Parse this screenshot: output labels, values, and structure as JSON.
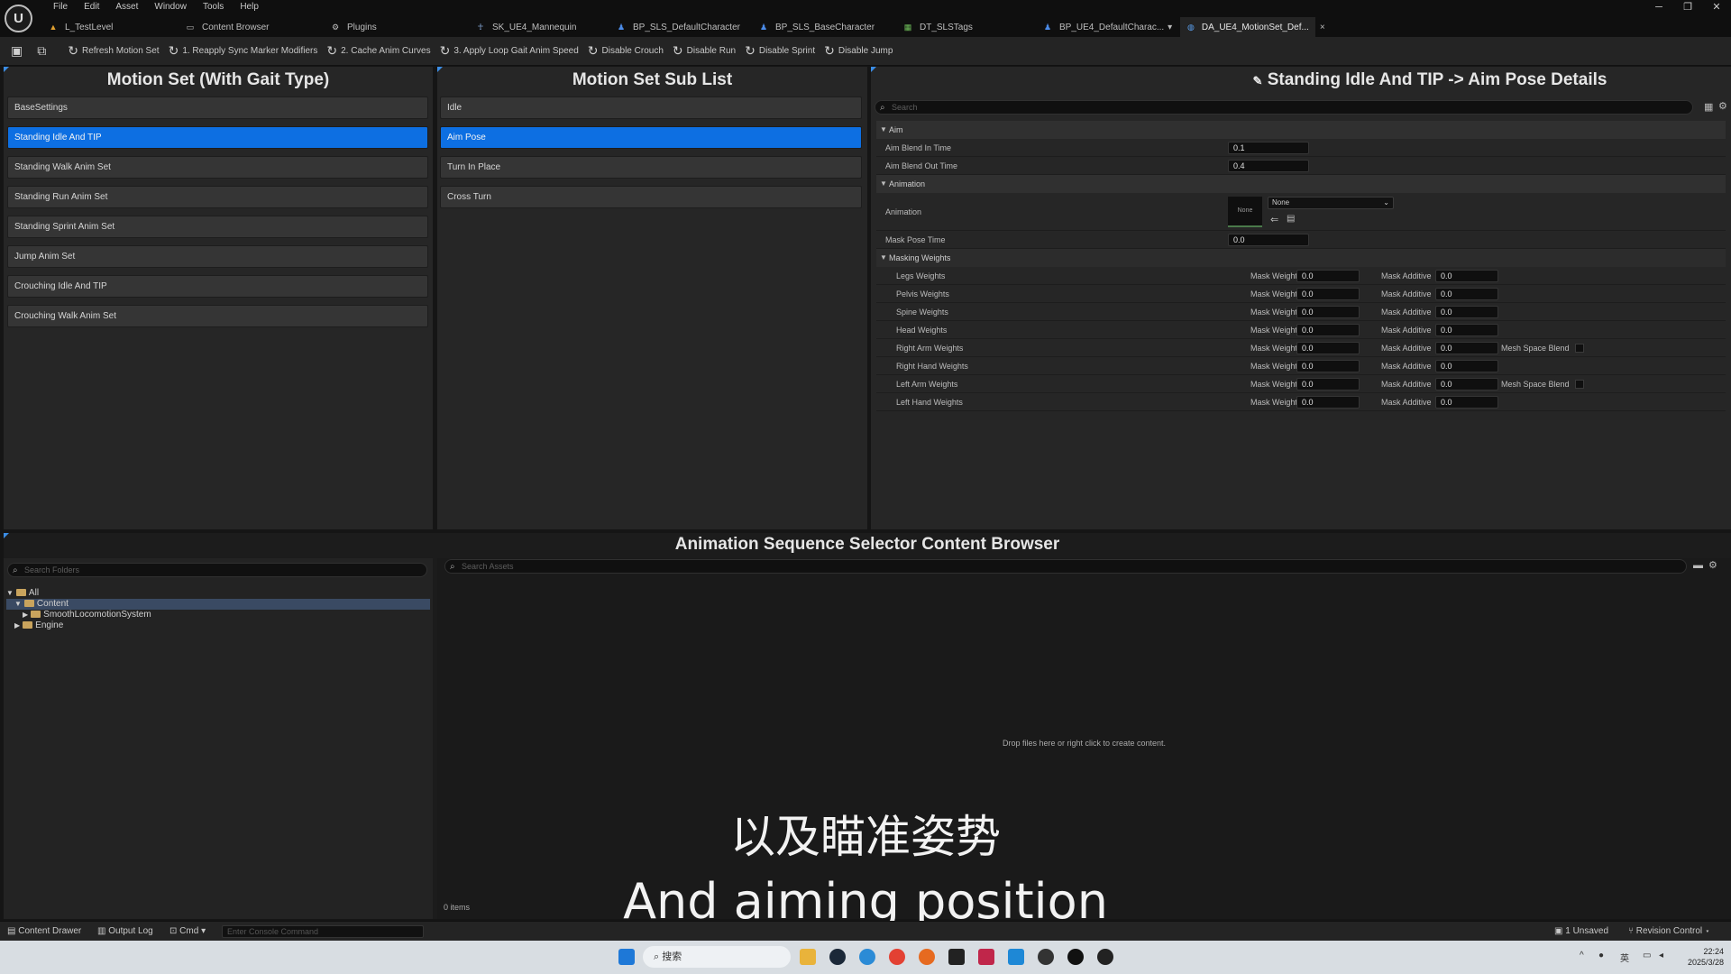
{
  "titlebar": {
    "logo": "U",
    "menus": [
      "File",
      "Edit",
      "Asset",
      "Window",
      "Tools",
      "Help"
    ],
    "tabs": [
      {
        "label": "L_TestLevel",
        "icon": "level-icon",
        "active": false
      },
      {
        "label": "Content Browser",
        "icon": "folder-icon",
        "active": false
      },
      {
        "label": "Plugins",
        "icon": "plugin-icon",
        "active": false
      },
      {
        "label": "SK_UE4_Mannequin",
        "icon": "skeleton-icon",
        "active": false
      },
      {
        "label": "BP_SLS_DefaultCharacter",
        "icon": "blueprint-icon",
        "active": false
      },
      {
        "label": "BP_SLS_BaseCharacter",
        "icon": "blueprint-icon",
        "active": false
      },
      {
        "label": "DT_SLSTags",
        "icon": "datatable-icon",
        "active": false
      },
      {
        "label": "BP_UE4_DefaultCharac...",
        "icon": "blueprint-icon",
        "active": false
      },
      {
        "label": "DA_UE4_MotionSet_Def...",
        "icon": "data-asset-icon",
        "active": true
      }
    ],
    "window_controls": [
      "─",
      "❐",
      "✕"
    ]
  },
  "toolbar": {
    "items": [
      "Refresh Motion Set",
      "1. Reapply Sync Marker Modifiers",
      "2. Cache Anim Curves",
      "3. Apply Loop Gait Anim Speed",
      "Disable Crouch",
      "Disable Run",
      "Disable Sprint",
      "Disable Jump"
    ]
  },
  "motion_set": {
    "title": "Motion Set (With Gait Type)",
    "items": [
      "BaseSettings",
      "Standing Idle And TIP",
      "Standing Walk Anim Set",
      "Standing Run Anim Set",
      "Standing Sprint Anim Set",
      "Jump Anim Set",
      "Crouching Idle And TIP",
      "Crouching Walk Anim Set"
    ],
    "selected_index": 1
  },
  "sub_list": {
    "title": "Motion Set Sub List",
    "items": [
      "Idle",
      "Aim Pose",
      "Turn In Place",
      "Cross Turn"
    ],
    "selected_index": 1
  },
  "details": {
    "title": "Standing Idle And TIP -> Aim Pose  Details",
    "search_placeholder": "Search",
    "aim": {
      "label": "Aim",
      "blend_in_label": "Aim Blend In Time",
      "blend_in_value": "0.1",
      "blend_out_label": "Aim Blend Out Time",
      "blend_out_value": "0.4"
    },
    "animation": {
      "label": "Animation",
      "anim_label": "Animation",
      "thumb_text": "None",
      "dropdown_value": "None",
      "mask_pose_label": "Mask Pose Time",
      "mask_pose_value": "0.0"
    },
    "masking": {
      "label": "Masking Weights",
      "mask_weight_label": "Mask Weight",
      "mask_additive_label": "Mask Additive",
      "mesh_space_label": "Mesh Space Blend",
      "rows": [
        {
          "label": "Legs Weights",
          "weight": "0.0",
          "additive": "0.0",
          "mesh_space": false
        },
        {
          "label": "Pelvis Weights",
          "weight": "0.0",
          "additive": "0.0",
          "mesh_space": false
        },
        {
          "label": "Spine Weights",
          "weight": "0.0",
          "additive": "0.0",
          "mesh_space": false
        },
        {
          "label": "Head Weights",
          "weight": "0.0",
          "additive": "0.0",
          "mesh_space": false
        },
        {
          "label": "Right Arm Weights",
          "weight": "0.0",
          "additive": "0.0",
          "mesh_space": true
        },
        {
          "label": "Right Hand Weights",
          "weight": "0.0",
          "additive": "0.0",
          "mesh_space": false
        },
        {
          "label": "Left Arm Weights",
          "weight": "0.0",
          "additive": "0.0",
          "mesh_space": true
        },
        {
          "label": "Left Hand Weights",
          "weight": "0.0",
          "additive": "0.0",
          "mesh_space": false
        }
      ]
    }
  },
  "content_browser": {
    "title": "Animation Sequence Selector Content Browser",
    "folder_search_placeholder": "Search Folders",
    "asset_search_placeholder": "Search Assets",
    "tree": [
      {
        "label": "All",
        "depth": 0,
        "selected": false
      },
      {
        "label": "Content",
        "depth": 1,
        "selected": true
      },
      {
        "label": "SmoothLocomotionSystem",
        "depth": 2,
        "selected": false
      },
      {
        "label": "Engine",
        "depth": 1,
        "selected": false
      }
    ],
    "empty_hint": "Drop files here or right click to create content.",
    "item_count": "0 items"
  },
  "subtitles": {
    "chinese": "以及瞄准姿势",
    "english": "And aiming position"
  },
  "statusbar": {
    "content_drawer": "Content Drawer",
    "output_log": "Output Log",
    "cmd": "Cmd",
    "console_placeholder": "Enter Console Command",
    "unsaved": "1 Unsaved",
    "revision_control": "Revision Control"
  },
  "taskbar": {
    "search_text": "搜索",
    "time": "22:24",
    "date": "2025/3/28"
  }
}
